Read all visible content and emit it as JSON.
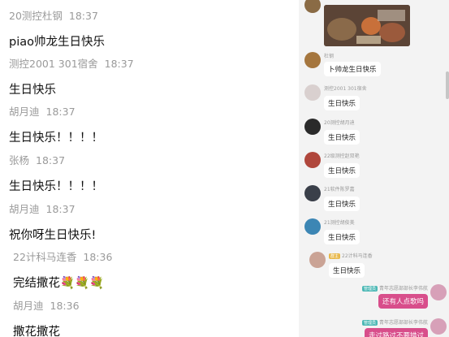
{
  "left_messages": [
    {
      "sender": "20测控杜钢",
      "time": "18:37",
      "text": "piao帅龙生日快乐"
    },
    {
      "sender": "测控2001 301宿舍",
      "time": "18:37",
      "text": "生日快乐"
    },
    {
      "sender": "胡月迪",
      "time": "18:37",
      "text": "生日快乐！！！！"
    },
    {
      "sender": "张杨",
      "time": "18:37",
      "text": "生日快乐！！！！"
    },
    {
      "sender": "胡月迪",
      "time": "18:37",
      "text": "祝你呀生日快乐!"
    },
    {
      "sender": "22计科马连香",
      "time": "18:36",
      "text": "完结撒花💐💐💐"
    },
    {
      "sender": "胡月迪",
      "time": "18:36",
      "text": "撒花撒花"
    }
  ],
  "right_messages": [
    {
      "sender": "杜钢",
      "text": "卜帅龙生日快乐"
    },
    {
      "sender": "测控2001 301宿舍",
      "text": "生日快乐"
    },
    {
      "sender": "20测控胡月迪",
      "text": "生日快乐"
    },
    {
      "sender": "22级测控赵双艳",
      "text": "生日快乐"
    },
    {
      "sender": "21软件陈罗嘉",
      "text": "生日快乐"
    },
    {
      "sender": "21测控胡俊美",
      "text": "生日快乐"
    },
    {
      "tag": "群主",
      "sender": "22计科马连香",
      "text": "生日快乐"
    }
  ],
  "right_mine": [
    {
      "tag": "管理员",
      "sender": "青年志愿部部长李伟航",
      "text": "还有人点歌吗"
    },
    {
      "tag": "管理员",
      "sender": "青年志愿部部长李伟航",
      "text": "走过路过不要错过"
    }
  ],
  "colors": {
    "accent": "#d84e8b",
    "right_bg": "#f3f3f3"
  }
}
